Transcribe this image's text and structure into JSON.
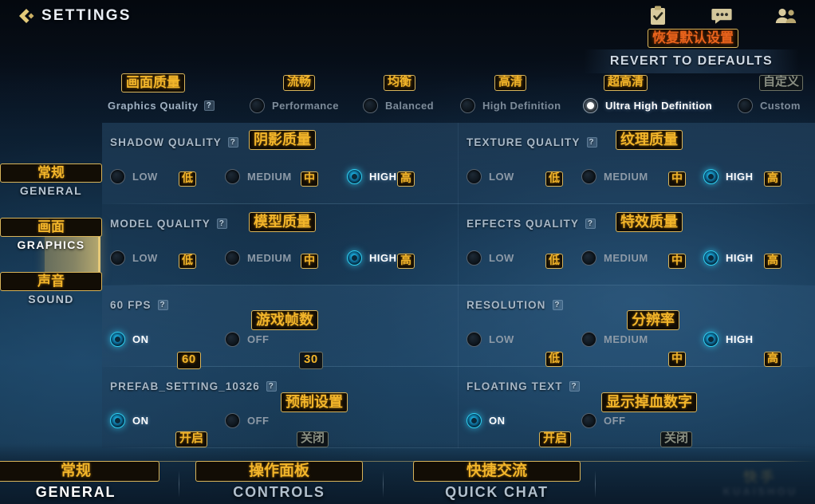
{
  "header": {
    "title": "SETTINGS",
    "back_icon": "back-arrow-icon",
    "icons": [
      {
        "name": "task-checklist-icon",
        "glyph": "checklist"
      },
      {
        "name": "chat-bubble-icon",
        "glyph": "chat"
      },
      {
        "name": "friends-icon",
        "glyph": "people"
      }
    ]
  },
  "revert": {
    "cn": "恢复默认设置",
    "label": "REVERT TO DEFAULTS"
  },
  "graphics_quality": {
    "cn": "画面质量",
    "label": "Graphics Quality",
    "info": "?",
    "options": [
      {
        "cn": "流畅",
        "label": "Performance",
        "selected": false
      },
      {
        "cn": "均衡",
        "label": "Balanced",
        "selected": false
      },
      {
        "cn": "高清",
        "label": "High Definition",
        "selected": false
      },
      {
        "cn": "超高清",
        "label": "Ultra High Definition",
        "selected": true
      },
      {
        "cn": "自定义",
        "label": "Custom",
        "selected": false
      }
    ]
  },
  "sidebar": {
    "items": [
      {
        "cn": "常规",
        "label": "GENERAL",
        "active": false
      },
      {
        "cn": "画面",
        "label": "GRAPHICS",
        "active": true
      },
      {
        "cn": "声音",
        "label": "SOUND",
        "active": false
      }
    ]
  },
  "settings": [
    {
      "title": "SHADOW QUALITY",
      "cn": "阴影质量",
      "info": "?",
      "options": [
        {
          "label": "LOW",
          "cn": "低",
          "selected": false
        },
        {
          "label": "MEDIUM",
          "cn": "中",
          "selected": false
        },
        {
          "label": "HIGH",
          "cn": "高",
          "selected": true
        }
      ]
    },
    {
      "title": "TEXTURE QUALITY",
      "cn": "纹理质量",
      "info": "?",
      "options": [
        {
          "label": "LOW",
          "cn": "低",
          "selected": false
        },
        {
          "label": "MEDIUM",
          "cn": "中",
          "selected": false
        },
        {
          "label": "HIGH",
          "cn": "高",
          "selected": true
        }
      ]
    },
    {
      "title": "MODEL QUALITY",
      "cn": "模型质量",
      "info": "?",
      "options": [
        {
          "label": "LOW",
          "cn": "低",
          "selected": false
        },
        {
          "label": "MEDIUM",
          "cn": "中",
          "selected": false
        },
        {
          "label": "HIGH",
          "cn": "高",
          "selected": true
        }
      ]
    },
    {
      "title": "EFFECTS QUALITY",
      "cn": "特效质量",
      "info": "?",
      "options": [
        {
          "label": "LOW",
          "cn": "低",
          "selected": false
        },
        {
          "label": "MEDIUM",
          "cn": "中",
          "selected": false
        },
        {
          "label": "HIGH",
          "cn": "高",
          "selected": true
        }
      ]
    },
    {
      "title": "60 FPS",
      "cn": "游戏帧数",
      "info": "?",
      "options": [
        {
          "label": "ON",
          "cn": "60",
          "selected": true
        },
        {
          "label": "OFF",
          "cn": "30",
          "selected": false
        }
      ]
    },
    {
      "title": "RESOLUTION",
      "cn": "分辨率",
      "info": "?",
      "options": [
        {
          "label": "LOW",
          "cn": "低",
          "selected": false
        },
        {
          "label": "MEDIUM",
          "cn": "中",
          "selected": false
        },
        {
          "label": "HIGH",
          "cn": "高",
          "selected": true
        }
      ]
    },
    {
      "title": "PREFAB_SETTING_10326",
      "cn": "预制设置",
      "info": "?",
      "options": [
        {
          "label": "ON",
          "cn": "开启",
          "selected": true
        },
        {
          "label": "OFF",
          "cn": "关闭",
          "selected": false
        }
      ]
    },
    {
      "title": "FLOATING TEXT",
      "cn": "显示掉血数字",
      "info": "?",
      "options": [
        {
          "label": "ON",
          "cn": "开启",
          "selected": true
        },
        {
          "label": "OFF",
          "cn": "关闭",
          "selected": false
        }
      ]
    }
  ],
  "bottom_nav": [
    {
      "cn": "常规",
      "label": "GENERAL",
      "active": true
    },
    {
      "cn": "操作面板",
      "label": "CONTROLS",
      "active": false
    },
    {
      "cn": "快捷交流",
      "label": "QUICK CHAT",
      "active": false
    }
  ],
  "watermark": {
    "line1": "快手",
    "line2": "KUAISHOU"
  },
  "colors": {
    "accent_gold": "#f2b52a",
    "accent_cyan": "#2fd1f5",
    "revert_red": "#e8631c",
    "panel_blue": "#2a4e6e"
  }
}
